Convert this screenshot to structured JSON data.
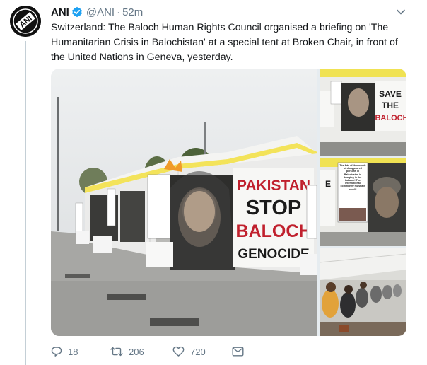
{
  "tweet": {
    "author_name": "ANI",
    "handle": "@ANI",
    "separator": "·",
    "time": "52m",
    "text": "Switzerland: The Baloch Human Rights Council organised a briefing on 'The Humanitarian Crisis in Balochistan' at a special tent at Broken Chair, in front of the United Nations in Geneva, yesterday.",
    "avatar_logo_text": "ANI"
  },
  "media": {
    "main_banner": [
      "PAKISTAN",
      "STOP",
      "BALOCH",
      "GENOCIDE"
    ],
    "thumb1_banner": [
      "SAVE",
      "THE",
      "BALOCH"
    ],
    "thumb2_sign": "The fate of thousands of disappeared persons in Balochistan is hanging in the balance! The international community must act now!!!"
  },
  "actions": {
    "reply_count": "18",
    "retweet_count": "206",
    "like_count": "720"
  },
  "icons": {
    "verified": "verified-badge-icon",
    "caret": "chevron-down-icon",
    "reply": "reply-icon",
    "retweet": "retweet-icon",
    "like": "heart-icon",
    "message": "envelope-icon"
  },
  "colors": {
    "verified_blue": "#1da1f2",
    "muted_text": "#657786",
    "thread_line": "#c4cfd6"
  }
}
